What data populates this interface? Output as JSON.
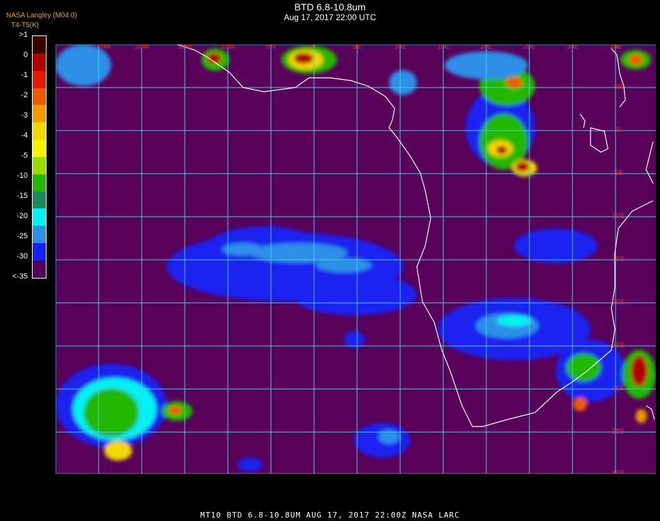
{
  "header": {
    "title": "BTD 6.8-10.8um",
    "datetime": "Aug 17, 2017 22:00 UTC"
  },
  "credit": "NASA Langley (M04.0)",
  "unit_label": "T4-T5(K)",
  "colorbar": {
    "labels": [
      ">1",
      "0",
      "-1",
      "-2",
      "-3",
      "-4",
      "-5",
      "-10",
      "-15",
      "-20",
      "-25",
      "-30",
      "<-35"
    ],
    "colors": [
      "#3c0000",
      "#b00000",
      "#e31a00",
      "#ee5a00",
      "#f29a00",
      "#f1d800",
      "#f4f400",
      "#9bdc00",
      "#24b800",
      "#1b8a5a",
      "#00f2f2",
      "#2d8fe8",
      "#1a22f0",
      "#58005a"
    ]
  },
  "map": {
    "background": "#58005a",
    "grid_color": "#40cfe0",
    "coast_color": "#ffffff",
    "label_color": "#ff2020",
    "lon_labels": [
      "25W",
      "20W",
      "15W",
      "10W",
      "5W",
      "0",
      "5E",
      "10E",
      "15E",
      "20E",
      "25E",
      "30E",
      "35E"
    ],
    "lat_labels": [
      "0",
      "5N",
      "0",
      "5S",
      "10S",
      "15S",
      "20S",
      "25S",
      "30S",
      "35S",
      "40S"
    ]
  },
  "footer": "MT10  BTD 6.8-10.8UM   AUG 17, 2017 22:00Z   NASA LARC"
}
